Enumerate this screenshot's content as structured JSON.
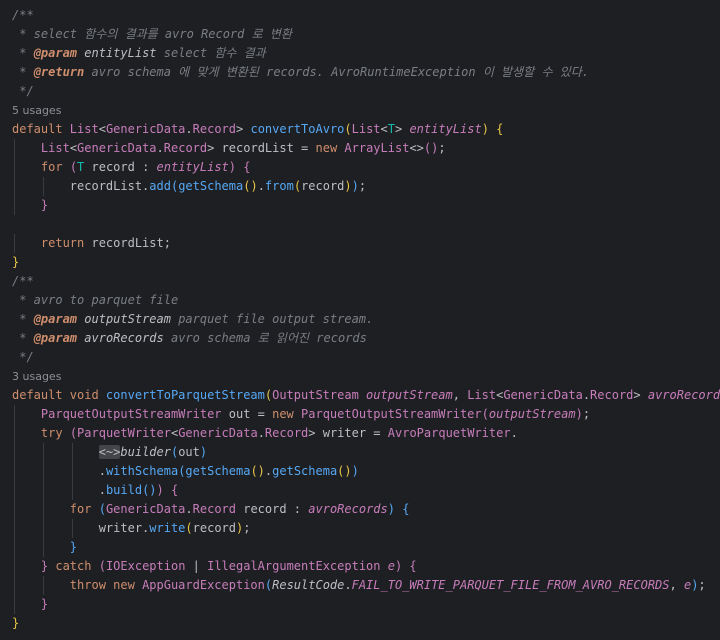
{
  "colors": {
    "background": "#1e1f22",
    "keyword": "#cf8e6d",
    "type": "#c77dbb",
    "comment": "#7a7e85",
    "function": "#56a8f5",
    "text": "#bcbec4",
    "bracket_yellow": "#e7c547",
    "type_param": "#16baac"
  },
  "lines": [
    {
      "tokens": [
        {
          "t": "/**",
          "c": "cmt"
        }
      ]
    },
    {
      "tokens": [
        {
          "t": " * select 함수의 결과를 avro Record 로 변환",
          "c": "cmt"
        }
      ]
    },
    {
      "tokens": [
        {
          "t": " * ",
          "c": "cmt"
        },
        {
          "t": "@param",
          "c": "doctag"
        },
        {
          "t": " entityList",
          "c": "docparam"
        },
        {
          "t": " select 함수 결과",
          "c": "cmt"
        }
      ]
    },
    {
      "tokens": [
        {
          "t": " * ",
          "c": "cmt"
        },
        {
          "t": "@return",
          "c": "doctag"
        },
        {
          "t": " avro schema 에 맞게 변환된 records. AvroRuntimeException 이 발생할 수 있다.",
          "c": "cmt"
        }
      ]
    },
    {
      "tokens": [
        {
          "t": " */",
          "c": "cmt"
        }
      ]
    },
    {
      "usages": "5 usages"
    },
    {
      "tokens": [
        {
          "t": "default ",
          "c": "kw"
        },
        {
          "t": "List",
          "c": "type"
        },
        {
          "t": "<",
          "c": "plain"
        },
        {
          "t": "GenericData",
          "c": "type"
        },
        {
          "t": ".",
          "c": "plain"
        },
        {
          "t": "Record",
          "c": "type"
        },
        {
          "t": "> ",
          "c": "plain"
        },
        {
          "t": "convertToAvro",
          "c": "fn"
        },
        {
          "t": "(",
          "c": "p1"
        },
        {
          "t": "List",
          "c": "type"
        },
        {
          "t": "<",
          "c": "plain"
        },
        {
          "t": "T",
          "c": "typeparam"
        },
        {
          "t": "> ",
          "c": "plain"
        },
        {
          "t": "entityList",
          "c": "paramit"
        },
        {
          "t": ") ",
          "c": "p1"
        },
        {
          "t": "{",
          "c": "p1"
        }
      ]
    },
    {
      "indent": 1,
      "tokens": [
        {
          "t": "List",
          "c": "type"
        },
        {
          "t": "<",
          "c": "plain"
        },
        {
          "t": "GenericData",
          "c": "type"
        },
        {
          "t": ".",
          "c": "plain"
        },
        {
          "t": "Record",
          "c": "type"
        },
        {
          "t": "> recordList = ",
          "c": "plain"
        },
        {
          "t": "new ",
          "c": "kw"
        },
        {
          "t": "ArrayList",
          "c": "type"
        },
        {
          "t": "<>",
          "c": "plain"
        },
        {
          "t": "()",
          "c": "p2"
        },
        {
          "t": ";",
          "c": "plain"
        }
      ]
    },
    {
      "indent": 1,
      "tokens": [
        {
          "t": "for ",
          "c": "kw"
        },
        {
          "t": "(",
          "c": "p2"
        },
        {
          "t": "T ",
          "c": "typeparam"
        },
        {
          "t": "record : ",
          "c": "plain"
        },
        {
          "t": "entityList",
          "c": "paramit"
        },
        {
          "t": ") ",
          "c": "p2"
        },
        {
          "t": "{",
          "c": "p2"
        }
      ]
    },
    {
      "indent": 2,
      "tokens": [
        {
          "t": "recordList.",
          "c": "plain"
        },
        {
          "t": "add",
          "c": "call"
        },
        {
          "t": "(",
          "c": "p3"
        },
        {
          "t": "getSchema",
          "c": "call"
        },
        {
          "t": "()",
          "c": "p1"
        },
        {
          "t": ".",
          "c": "plain"
        },
        {
          "t": "from",
          "c": "call"
        },
        {
          "t": "(",
          "c": "p1"
        },
        {
          "t": "record",
          "c": "plain"
        },
        {
          "t": ")",
          "c": "p1"
        },
        {
          "t": ")",
          "c": "p3"
        },
        {
          "t": ";",
          "c": "plain"
        }
      ]
    },
    {
      "indent": 1,
      "tokens": [
        {
          "t": "}",
          "c": "p2"
        }
      ]
    },
    {
      "tokens": []
    },
    {
      "indent": 1,
      "tokens": [
        {
          "t": "return ",
          "c": "kw"
        },
        {
          "t": "recordList;",
          "c": "plain"
        }
      ]
    },
    {
      "tokens": [
        {
          "t": "}",
          "c": "p1"
        }
      ]
    },
    {
      "tokens": [
        {
          "t": "/**",
          "c": "cmt"
        }
      ]
    },
    {
      "tokens": [
        {
          "t": " * avro to parquet file",
          "c": "cmt"
        }
      ]
    },
    {
      "tokens": [
        {
          "t": " * ",
          "c": "cmt"
        },
        {
          "t": "@param",
          "c": "doctag"
        },
        {
          "t": " outputStream",
          "c": "docparam"
        },
        {
          "t": " parquet file output stream.",
          "c": "cmt"
        }
      ]
    },
    {
      "tokens": [
        {
          "t": " * ",
          "c": "cmt"
        },
        {
          "t": "@param",
          "c": "doctag"
        },
        {
          "t": " avroRecords",
          "c": "docparam"
        },
        {
          "t": " avro schema 로 읽어진 records",
          "c": "cmt"
        }
      ]
    },
    {
      "tokens": [
        {
          "t": " */",
          "c": "cmt"
        }
      ]
    },
    {
      "usages": "3 usages"
    },
    {
      "tokens": [
        {
          "t": "default ",
          "c": "kw"
        },
        {
          "t": "void ",
          "c": "kw"
        },
        {
          "t": "convertToParquetStream",
          "c": "fn"
        },
        {
          "t": "(",
          "c": "p1"
        },
        {
          "t": "OutputStream ",
          "c": "type"
        },
        {
          "t": "outputStream",
          "c": "paramit"
        },
        {
          "t": ", ",
          "c": "plain"
        },
        {
          "t": "List",
          "c": "type"
        },
        {
          "t": "<",
          "c": "plain"
        },
        {
          "t": "GenericData",
          "c": "type"
        },
        {
          "t": ".",
          "c": "plain"
        },
        {
          "t": "Record",
          "c": "type"
        },
        {
          "t": "> ",
          "c": "plain"
        },
        {
          "t": "avroRecords",
          "c": "paramit"
        },
        {
          "t": ") ",
          "c": "p1"
        },
        {
          "t": "{",
          "c": "p1"
        }
      ]
    },
    {
      "indent": 1,
      "tokens": [
        {
          "t": "ParquetOutputStreamWriter ",
          "c": "type"
        },
        {
          "t": "out = ",
          "c": "plain"
        },
        {
          "t": "new ",
          "c": "kw"
        },
        {
          "t": "ParquetOutputStreamWriter",
          "c": "type"
        },
        {
          "t": "(",
          "c": "p2"
        },
        {
          "t": "outputStream",
          "c": "paramit"
        },
        {
          "t": ")",
          "c": "p2"
        },
        {
          "t": ";",
          "c": "plain"
        }
      ]
    },
    {
      "indent": 1,
      "tokens": [
        {
          "t": "try ",
          "c": "kw"
        },
        {
          "t": "(",
          "c": "p2"
        },
        {
          "t": "ParquetWriter",
          "c": "type"
        },
        {
          "t": "<",
          "c": "plain"
        },
        {
          "t": "GenericData",
          "c": "type"
        },
        {
          "t": ".",
          "c": "plain"
        },
        {
          "t": "Record",
          "c": "type"
        },
        {
          "t": "> writer = ",
          "c": "plain"
        },
        {
          "t": "AvroParquetWriter",
          "c": "type"
        },
        {
          "t": ".",
          "c": "plain"
        }
      ]
    },
    {
      "indent": 3,
      "tokens": [
        {
          "t": "<~>",
          "c": "fold"
        },
        {
          "t": "builder",
          "c": "italic-call"
        },
        {
          "t": "(",
          "c": "p3"
        },
        {
          "t": "out",
          "c": "plain"
        },
        {
          "t": ")",
          "c": "p3"
        }
      ]
    },
    {
      "indent": 3,
      "tokens": [
        {
          "t": ".",
          "c": "plain"
        },
        {
          "t": "withSchema",
          "c": "call"
        },
        {
          "t": "(",
          "c": "p3"
        },
        {
          "t": "getSchema",
          "c": "call"
        },
        {
          "t": "()",
          "c": "p1"
        },
        {
          "t": ".",
          "c": "plain"
        },
        {
          "t": "getSchema",
          "c": "call"
        },
        {
          "t": "()",
          "c": "p1"
        },
        {
          "t": ")",
          "c": "p3"
        }
      ]
    },
    {
      "indent": 3,
      "tokens": [
        {
          "t": ".",
          "c": "plain"
        },
        {
          "t": "build",
          "c": "call"
        },
        {
          "t": "()",
          "c": "p3"
        },
        {
          "t": ") ",
          "c": "p2"
        },
        {
          "t": "{",
          "c": "p2"
        }
      ]
    },
    {
      "indent": 2,
      "tokens": [
        {
          "t": "for ",
          "c": "kw"
        },
        {
          "t": "(",
          "c": "p3"
        },
        {
          "t": "GenericData",
          "c": "type"
        },
        {
          "t": ".",
          "c": "plain"
        },
        {
          "t": "Record ",
          "c": "type"
        },
        {
          "t": "record : ",
          "c": "plain"
        },
        {
          "t": "avroRecords",
          "c": "paramit"
        },
        {
          "t": ") ",
          "c": "p3"
        },
        {
          "t": "{",
          "c": "p3"
        }
      ]
    },
    {
      "indent": 3,
      "tokens": [
        {
          "t": "writer.",
          "c": "plain"
        },
        {
          "t": "write",
          "c": "call"
        },
        {
          "t": "(",
          "c": "p1"
        },
        {
          "t": "record",
          "c": "plain"
        },
        {
          "t": ")",
          "c": "p1"
        },
        {
          "t": ";",
          "c": "plain"
        }
      ]
    },
    {
      "indent": 2,
      "tokens": [
        {
          "t": "}",
          "c": "p3"
        }
      ]
    },
    {
      "indent": 1,
      "tokens": [
        {
          "t": "} ",
          "c": "p2"
        },
        {
          "t": "catch ",
          "c": "kw"
        },
        {
          "t": "(",
          "c": "p2"
        },
        {
          "t": "IOException ",
          "c": "type"
        },
        {
          "t": "| ",
          "c": "plain"
        },
        {
          "t": "IllegalArgumentException ",
          "c": "type"
        },
        {
          "t": "e",
          "c": "paramit"
        },
        {
          "t": ") ",
          "c": "p2"
        },
        {
          "t": "{",
          "c": "p2"
        }
      ]
    },
    {
      "indent": 2,
      "tokens": [
        {
          "t": "throw ",
          "c": "kw"
        },
        {
          "t": "new ",
          "c": "kw"
        },
        {
          "t": "AppGuardException",
          "c": "type"
        },
        {
          "t": "(",
          "c": "p3"
        },
        {
          "t": "ResultCode",
          "c": "static"
        },
        {
          "t": ".",
          "c": "plain"
        },
        {
          "t": "FAIL_TO_WRITE_PARQUET_FILE_FROM_AVRO_RECORDS",
          "c": "const"
        },
        {
          "t": ", ",
          "c": "plain"
        },
        {
          "t": "e",
          "c": "paramit"
        },
        {
          "t": ")",
          "c": "p3"
        },
        {
          "t": ";",
          "c": "plain"
        }
      ]
    },
    {
      "indent": 1,
      "tokens": [
        {
          "t": "}",
          "c": "p2"
        }
      ]
    },
    {
      "tokens": [
        {
          "t": "}",
          "c": "p1"
        }
      ]
    }
  ]
}
